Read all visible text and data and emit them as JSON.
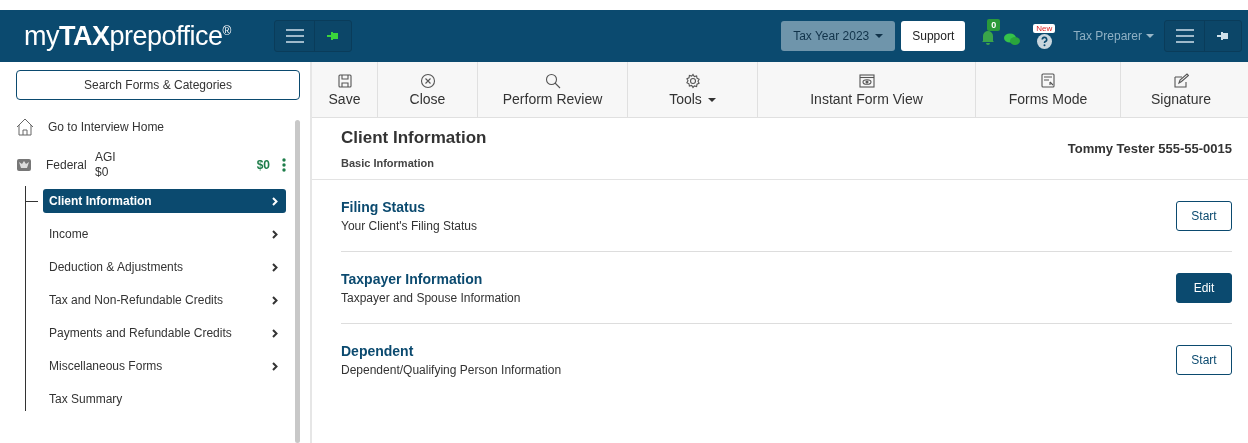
{
  "header": {
    "logo": {
      "light": "my",
      "bold": "TAX",
      "mid": "prep",
      "end": "office",
      "mark": "®"
    },
    "tax_year": "Tax Year 2023",
    "support": "Support",
    "notifications": "0",
    "help_badge": "New",
    "user": "Tax Preparer"
  },
  "sidebar": {
    "search": "Search Forms & Categories",
    "home": "Go to Interview Home",
    "federal": {
      "label": "Federal",
      "agi_label": "AGI",
      "agi_value": "$0",
      "amount": "$0"
    },
    "items": [
      {
        "label": "Client Information",
        "selected": true,
        "kind": "group"
      },
      {
        "label": "Income",
        "selected": false,
        "kind": "group"
      },
      {
        "label": "Deduction & Adjustments",
        "selected": false,
        "kind": "group"
      },
      {
        "label": "Tax and Non-Refundable Credits",
        "selected": false,
        "kind": "group"
      },
      {
        "label": "Payments and Refundable Credits",
        "selected": false,
        "kind": "group"
      },
      {
        "label": "Miscellaneous Forms",
        "selected": false,
        "kind": "group"
      },
      {
        "label": "Tax Summary",
        "selected": false,
        "kind": "link"
      }
    ]
  },
  "toolbar": [
    {
      "label": "Save",
      "kind": "save"
    },
    {
      "label": "Close",
      "kind": "close"
    },
    {
      "label": "Perform Review",
      "kind": "search"
    },
    {
      "label": "Tools",
      "kind": "tools"
    },
    {
      "label": "Instant Form View",
      "kind": "view"
    },
    {
      "label": "Forms Mode",
      "kind": "forms"
    },
    {
      "label": "Signature",
      "kind": "signature"
    }
  ],
  "page": {
    "title": "Client Information",
    "subtitle": "Basic Information",
    "client": "Tommy Tester 555-55-0015",
    "sections": [
      {
        "title": "Filing Status",
        "description": "Your Client's Filing Status",
        "action": "Start",
        "kind": "outline"
      },
      {
        "title": "Taxpayer Information",
        "description": "Taxpayer and Spouse Information",
        "action": "Edit",
        "kind": "filled"
      },
      {
        "title": "Dependent",
        "description": "Dependent/Qualifying Person Information",
        "action": "Start",
        "kind": "outline"
      }
    ]
  }
}
